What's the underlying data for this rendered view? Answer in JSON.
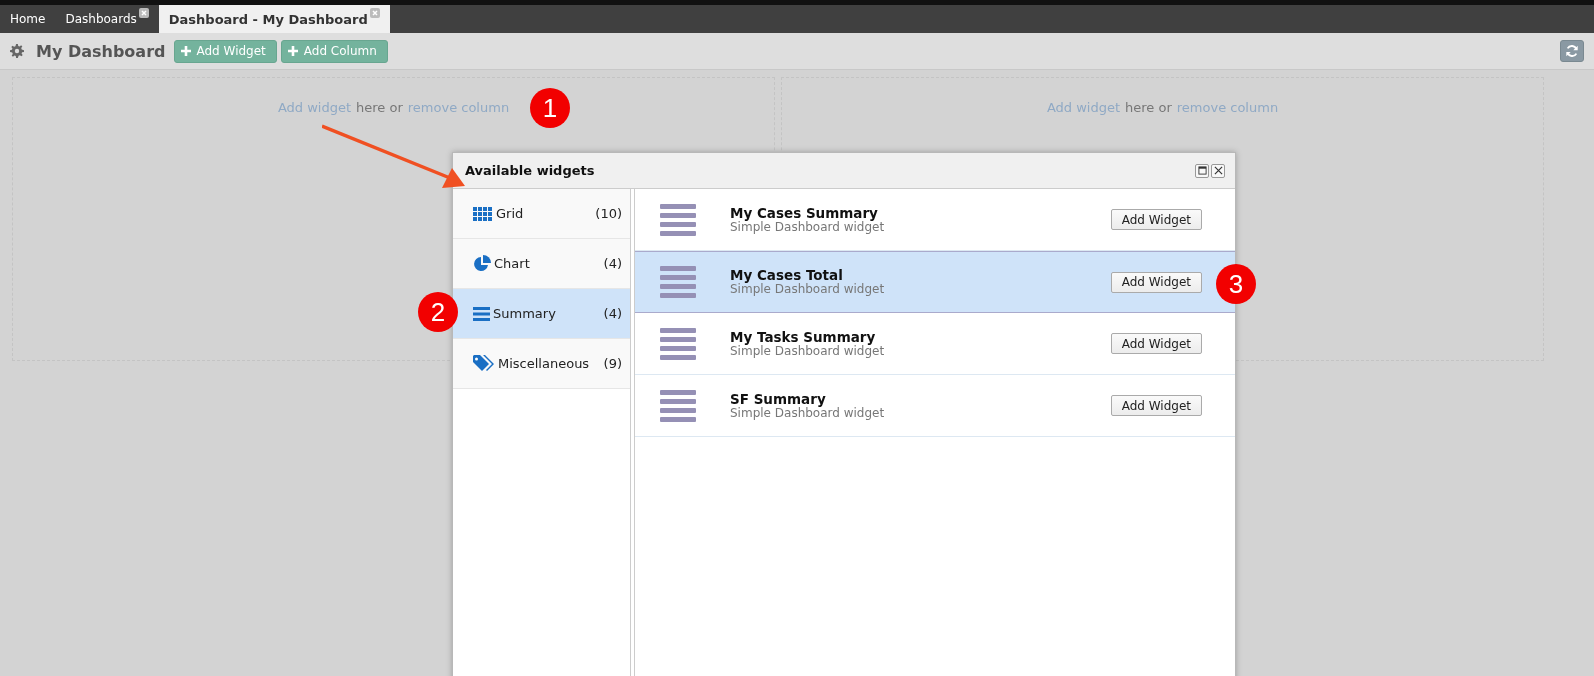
{
  "tabs": [
    {
      "label": "Home",
      "closable": false,
      "selected": false
    },
    {
      "label": "Dashboards",
      "closable": true,
      "selected": false
    },
    {
      "label": "Dashboard - My Dashboard",
      "closable": true,
      "selected": true
    }
  ],
  "toolbar": {
    "title": "My Dashboard",
    "buttons": [
      "Add Widget",
      "Add Column"
    ]
  },
  "columns": [
    {
      "add_link": "Add widget",
      "middle": "here or",
      "remove_link": "remove column"
    },
    {
      "add_link": "Add widget",
      "middle": "here or",
      "remove_link": "remove column"
    }
  ],
  "dialog": {
    "title": "Available widgets",
    "categories": [
      {
        "kind": "grid",
        "label": "Grid",
        "count": "(10)",
        "selected": false
      },
      {
        "kind": "chart",
        "label": "Chart",
        "count": "(4)",
        "selected": false
      },
      {
        "kind": "summary",
        "label": "Summary",
        "count": "(4)",
        "selected": true
      },
      {
        "kind": "tag",
        "label": "Miscellaneous",
        "count": "(9)",
        "selected": false
      }
    ],
    "widgets": [
      {
        "name": "My Cases Summary",
        "description": "Simple Dashboard widget",
        "button": "Add Widget",
        "selected": false
      },
      {
        "name": "My Cases Total",
        "description": "Simple Dashboard widget",
        "button": "Add Widget",
        "selected": true
      },
      {
        "name": "My Tasks Summary",
        "description": "Simple Dashboard widget",
        "button": "Add Widget",
        "selected": false
      },
      {
        "name": "SF Summary",
        "description": "Simple Dashboard widget",
        "button": "Add Widget",
        "selected": false
      }
    ]
  },
  "callouts": [
    "1",
    "2",
    "3"
  ]
}
